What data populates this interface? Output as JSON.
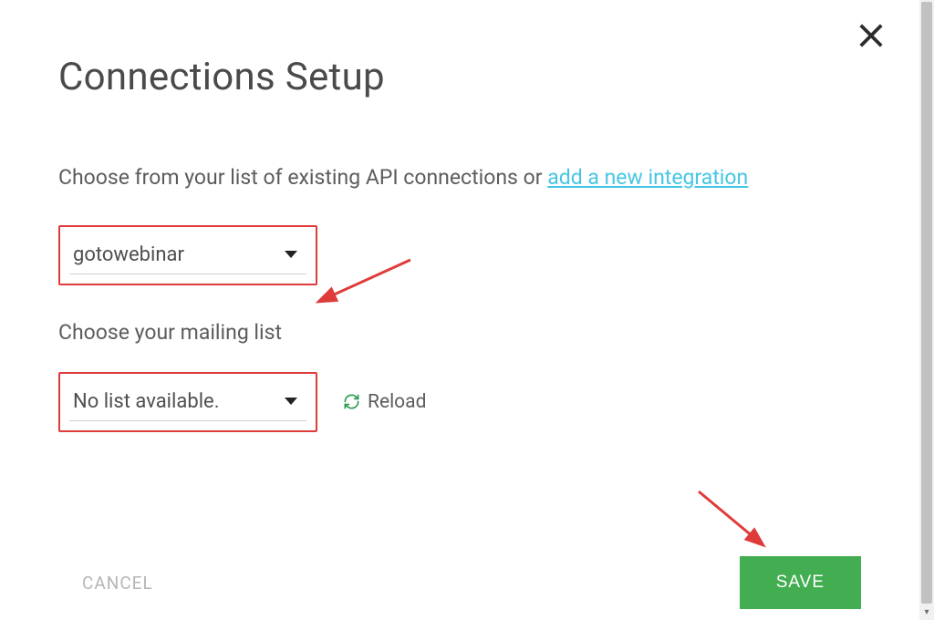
{
  "dialog": {
    "title": "Connections Setup",
    "intro_text": "Choose from your list of existing API connections or ",
    "add_link_text": "add a new integration",
    "mailing_label": "Choose your mailing list",
    "reload_label": "Reload"
  },
  "selects": {
    "connection": {
      "value": "gotowebinar"
    },
    "mailing_list": {
      "value": "No list available."
    }
  },
  "buttons": {
    "cancel": "CANCEL",
    "save": "SAVE"
  },
  "colors": {
    "highlight_border": "#e03b3b",
    "link": "#46c6e4",
    "save_bg": "#43ad51"
  }
}
